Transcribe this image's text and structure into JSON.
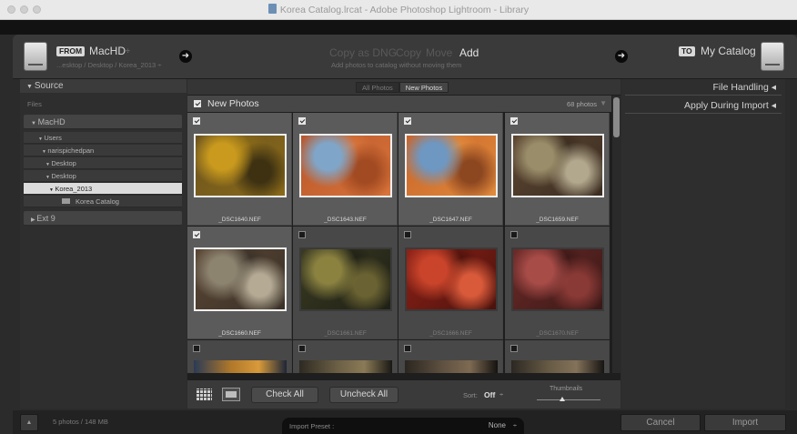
{
  "window": {
    "title": "Korea Catalog.lrcat - Adobe Photoshop Lightroom - Library"
  },
  "header": {
    "from_tag": "FROM",
    "source_name": "MacHD",
    "source_dropdown_glyph": "÷",
    "source_path": "...esktop / Desktop / Korea_2013 ÷",
    "modes": [
      "Copy as DNG",
      "Copy",
      "Move",
      "Add"
    ],
    "active_mode": "Add",
    "mode_hint": "Add photos to catalog without moving them",
    "to_tag": "TO",
    "destination_name": "My Catalog",
    "arrow_glyph": "➜"
  },
  "source_panel": {
    "title": "Source",
    "files_label": "Files",
    "drive": "MacHD",
    "tree": [
      "Users",
      "narispichedpan",
      "Desktop",
      "Desktop",
      "Korea_2013",
      "Korea Catalog"
    ],
    "selected_folder": "Korea_2013",
    "other_drive": "Ext 9"
  },
  "right_panel": {
    "file_handling": "File Handling",
    "apply_during_import": "Apply During Import",
    "collapse_glyph": "◂"
  },
  "grid": {
    "tabs": [
      "All Photos",
      "New Photos"
    ],
    "active_tab": "New Photos",
    "group_title": "New Photos",
    "count_label": "68 photos",
    "photos": [
      {
        "file": "_DSC1640.NEF",
        "checked": true,
        "colors": [
          "#6b5320",
          "#c99a1d",
          "#8a6a18",
          "#3d3112"
        ]
      },
      {
        "file": "_DSC1643.NEF",
        "checked": true,
        "colors": [
          "#b8562a",
          "#7fa6c9",
          "#d9743a",
          "#a24a22"
        ]
      },
      {
        "file": "_DSC1647.NEF",
        "checked": true,
        "colors": [
          "#c8642a",
          "#6e97c2",
          "#e08a3c",
          "#8d4720"
        ]
      },
      {
        "file": "_DSC1659.NEF",
        "checked": true,
        "colors": [
          "#5d4632",
          "#9a8e6a",
          "#3a2c20",
          "#b2a88d"
        ]
      },
      {
        "file": "_DSC1660.NEF",
        "checked": true,
        "colors": [
          "#5a4634",
          "#8d8470",
          "#3a3128",
          "#b5ab95"
        ]
      },
      {
        "file": "_DSC1661.NEF",
        "checked": false,
        "colors": [
          "#3a3a22",
          "#8b8240",
          "#1f2015",
          "#6a6232"
        ]
      },
      {
        "file": "_DSC1666.NEF",
        "checked": false,
        "colors": [
          "#8e2218",
          "#c9442a",
          "#4a120c",
          "#d85a3a"
        ]
      },
      {
        "file": "_DSC1670.NEF",
        "checked": false,
        "colors": [
          "#6a2a28",
          "#a84c48",
          "#3a1816",
          "#8a3a36"
        ]
      },
      {
        "file": "",
        "checked": false,
        "colors": [
          "#2a3a55",
          "#b0782a",
          "#1c2638",
          "#d89a3a"
        ]
      },
      {
        "file": "",
        "checked": false,
        "colors": [
          "#2e2a22",
          "#6a5e44",
          "#1a1814",
          "#8a7a56"
        ]
      },
      {
        "file": "",
        "checked": false,
        "colors": [
          "#2a2620",
          "#5e5040",
          "#141210",
          "#7e6a52"
        ]
      },
      {
        "file": "",
        "checked": false,
        "colors": [
          "#2c2822",
          "#665a44",
          "#161412",
          "#84725a"
        ]
      }
    ]
  },
  "toolbar": {
    "check_all": "Check All",
    "uncheck_all": "Uncheck All",
    "sort_label": "Sort:",
    "sort_value": "Off",
    "sort_glyph": "÷",
    "thumbnails_label": "Thumbnails"
  },
  "bottom": {
    "toggle_glyph": "▲",
    "summary": "5 photos / 148 MB",
    "preset_label": "Import Preset :",
    "preset_value": "None",
    "preset_glyph": "÷",
    "cancel": "Cancel",
    "import": "Import"
  },
  "colors": {
    "background": "#2b2b2b",
    "panel": "#2e2e2e",
    "cell": "#5b5b5b",
    "cell_dim": "#484848",
    "active_text": "#e3e3e3",
    "selected_row": "#dcdcdc"
  },
  "icons": {
    "traffic_lights": "traffic-light-icons",
    "document": "document-icon",
    "hard_drive": "hard-drive-icon",
    "arrow": "arrow-right-icon",
    "checkbox": "checkbox-icon",
    "grid_view": "grid-view-icon",
    "loupe_view": "loupe-view-icon",
    "folder": "folder-icon",
    "disclosure": "disclosure-triangle-icon"
  }
}
